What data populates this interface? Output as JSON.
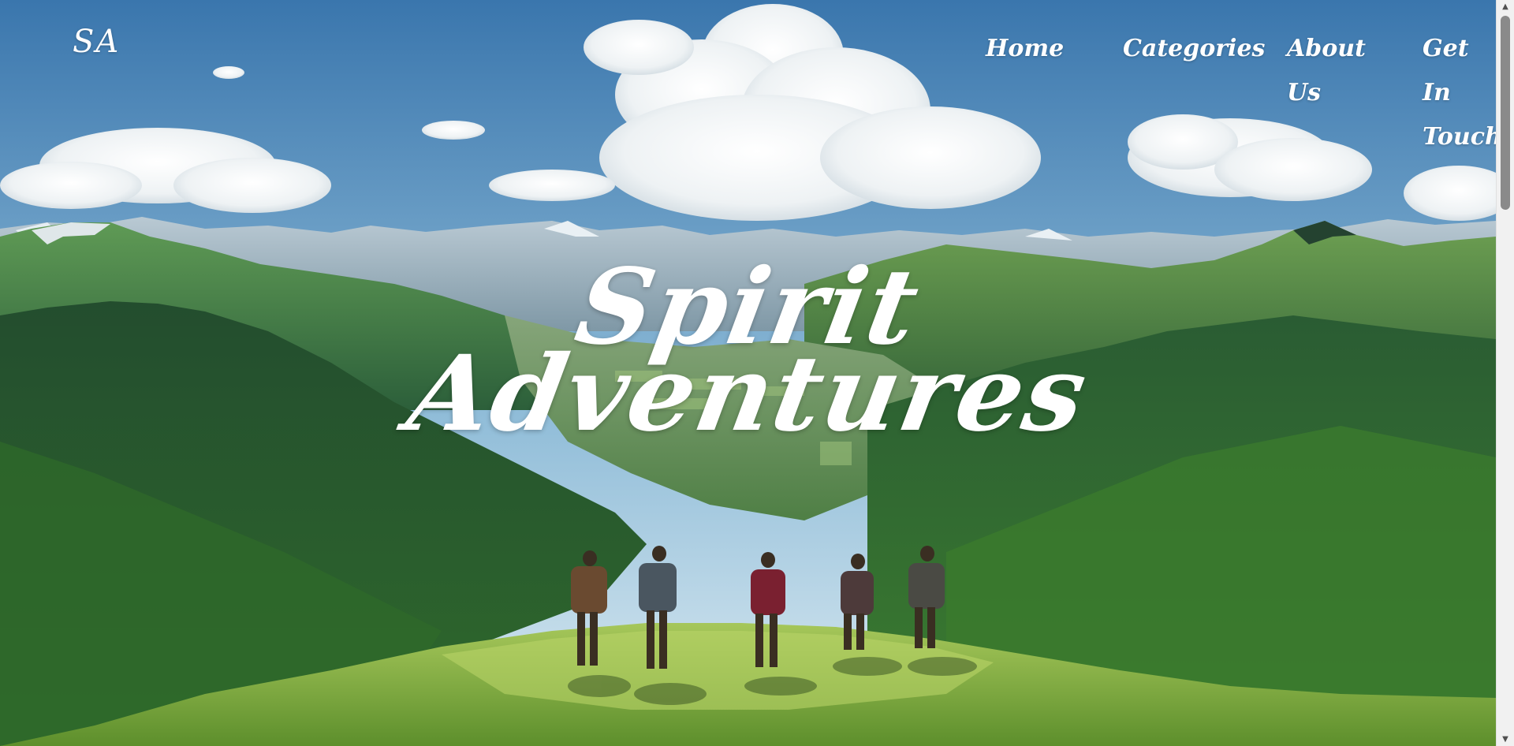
{
  "header": {
    "brand": "SA",
    "nav": [
      {
        "lines": [
          "Home"
        ]
      },
      {
        "lines": [
          "Categories"
        ]
      },
      {
        "lines": [
          "About",
          "Us"
        ]
      },
      {
        "lines": [
          "Get In",
          "Touch"
        ]
      }
    ]
  },
  "hero": {
    "title_line1": "Spirit",
    "title_line2": "Adventures",
    "background": "mountain-valley-hikers-image"
  },
  "colors": {
    "sky_top": "#3f7fb5",
    "sky_bottom": "#cfe3ee",
    "mountain_far": "#9fb6c4",
    "forest_dark": "#1f4a2a",
    "forest_mid": "#2f6b35",
    "grass": "#7fb24a",
    "text": "#ffffff"
  },
  "scrollbar": {
    "up_icon": "scroll-up-arrow-icon",
    "down_icon": "scroll-down-arrow-icon"
  }
}
